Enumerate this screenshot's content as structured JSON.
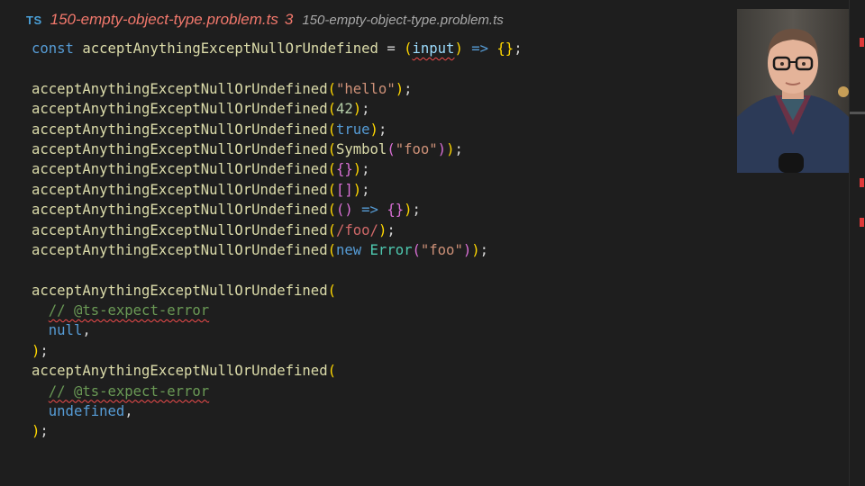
{
  "tab": {
    "badge": "TS",
    "title": "150-empty-object-type.problem.ts",
    "problem_count": "3",
    "description": "150-empty-object-type.problem.ts"
  },
  "code": {
    "const_kw": "const",
    "fn_name": "acceptAnythingExceptNullOrUndefined",
    "eq": " = ",
    "param": "input",
    "arrow": "=>",
    "empty_obj": "{}",
    "semi": ";",
    "str_hello": "\"hello\"",
    "num_42": "42",
    "lit_true": "true",
    "symbol_fn": "Symbol",
    "str_foo": "\"foo\"",
    "arr_empty": "[]",
    "regex_foo": "/foo/",
    "new_kw": "new",
    "error_cls": "Error",
    "comment_expect": "// @ts-expect-error",
    "lit_null": "null",
    "lit_undefined": "undefined",
    "comma": ","
  },
  "webcam": {
    "description": "presenter-webcam"
  }
}
